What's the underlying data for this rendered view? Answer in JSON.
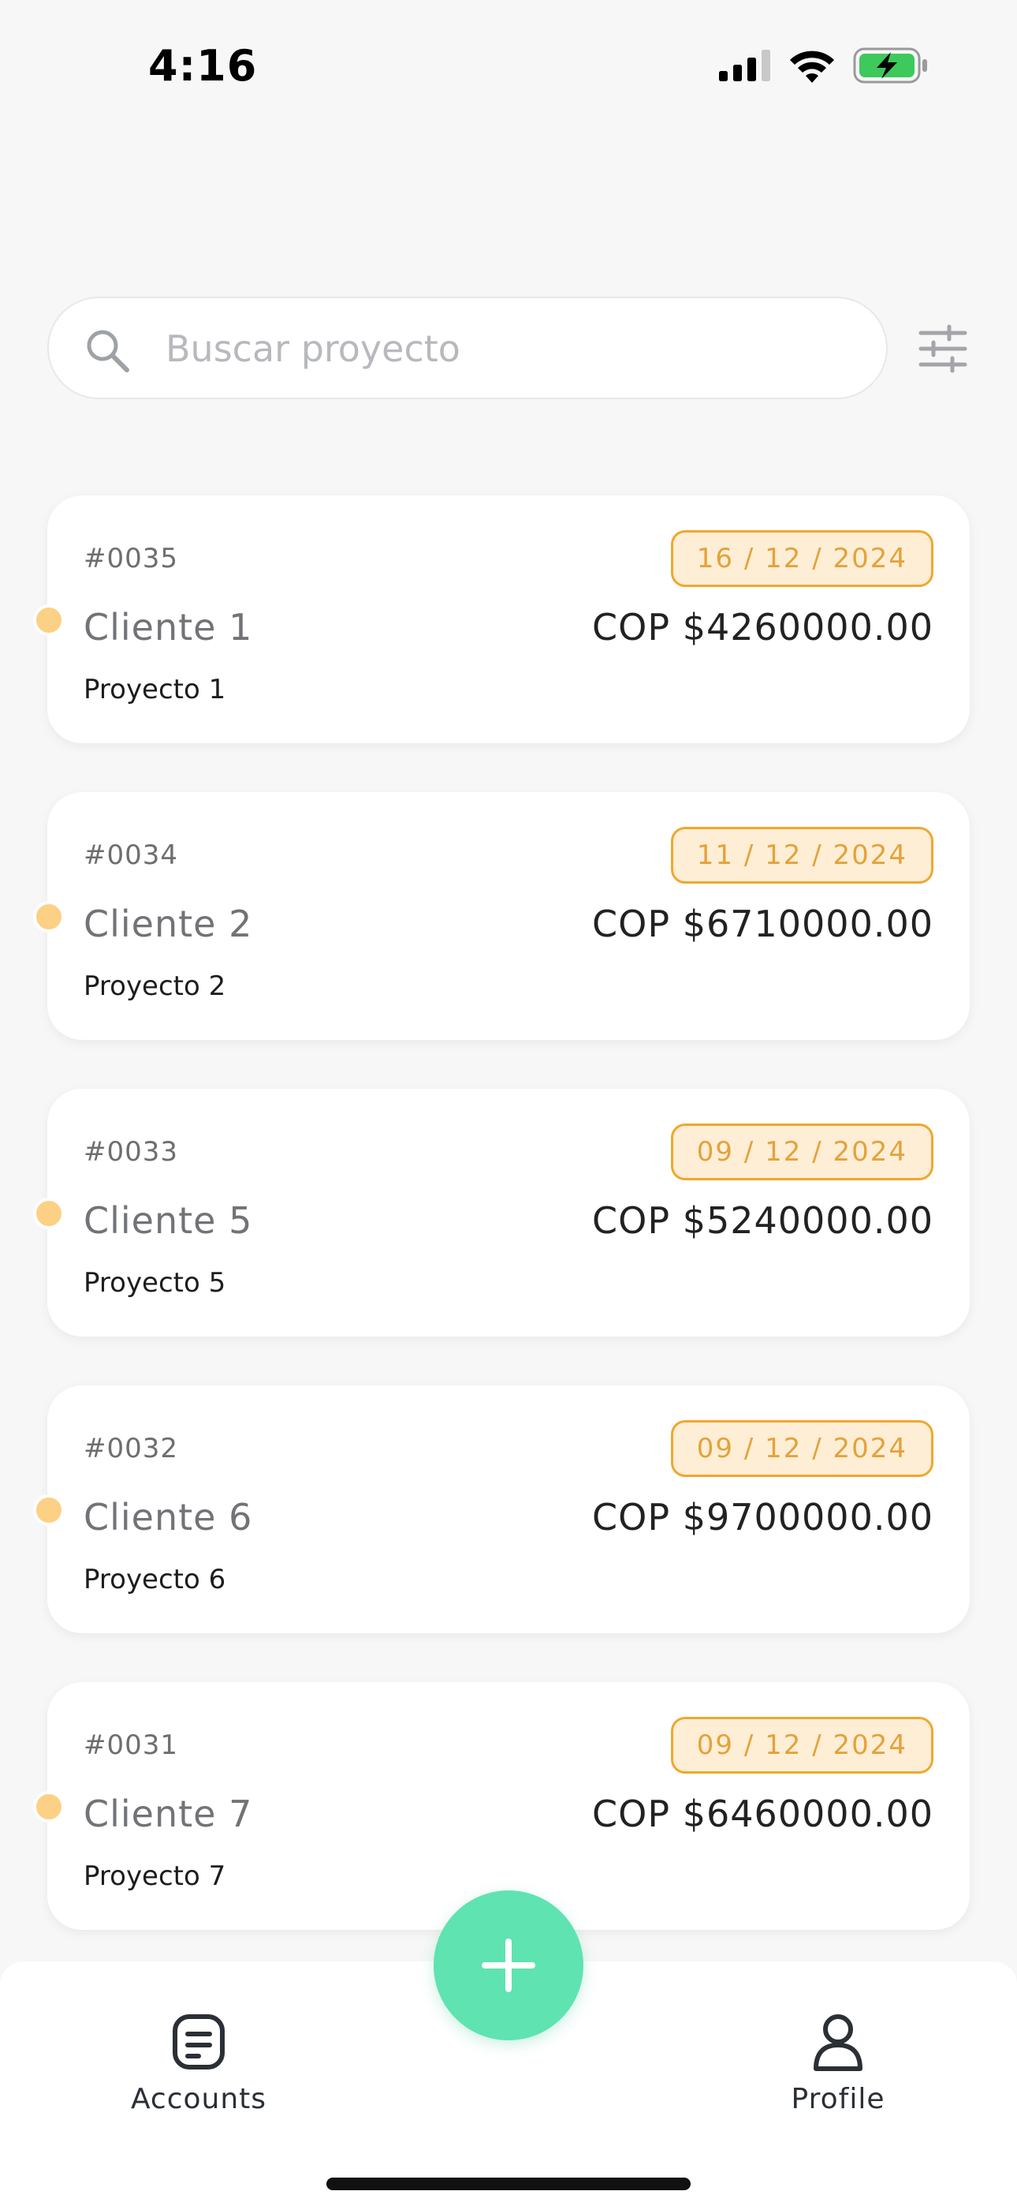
{
  "status_bar": {
    "time": "4:16",
    "icons": [
      "cellular-signal-icon",
      "wifi-icon",
      "battery-charging-icon"
    ]
  },
  "search": {
    "placeholder": "Buscar proyecto",
    "value": "",
    "icon": "search-icon",
    "filter_icon": "filter-sliders-icon"
  },
  "projects": [
    {
      "id": "#0035",
      "client": "Cliente 1",
      "project": "Proyecto 1",
      "date": "16 / 12 / 2024",
      "amount": "COP $4260000.00"
    },
    {
      "id": "#0034",
      "client": "Cliente 2",
      "project": "Proyecto 2",
      "date": "11 / 12 / 2024",
      "amount": "COP $6710000.00"
    },
    {
      "id": "#0033",
      "client": "Cliente 5",
      "project": "Proyecto 5",
      "date": "09 / 12 / 2024",
      "amount": "COP $5240000.00"
    },
    {
      "id": "#0032",
      "client": "Cliente 6",
      "project": "Proyecto 6",
      "date": "09 / 12 / 2024",
      "amount": "COP $9700000.00"
    },
    {
      "id": "#0031",
      "client": "Cliente 7",
      "project": "Proyecto 7",
      "date": "09 / 12 / 2024",
      "amount": "COP $6460000.00"
    }
  ],
  "nav": {
    "accounts_label": "Accounts",
    "profile_label": "Profile",
    "fab_icon": "plus-icon"
  },
  "colors": {
    "accent_green": "#5ee3b1",
    "status_dot": "#fcd185",
    "date_badge_border": "#f0a72e",
    "date_badge_bg": "#fdeed5",
    "date_badge_text": "#e4a23b",
    "background": "#f7f7f7"
  }
}
